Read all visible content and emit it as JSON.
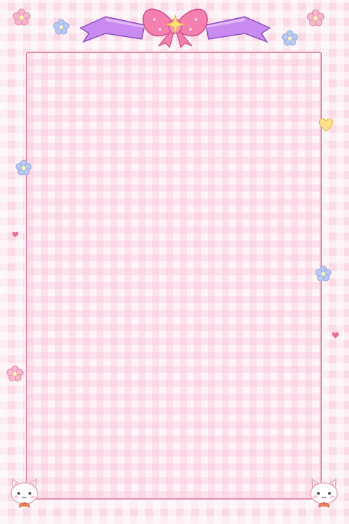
{
  "stationery": {
    "pattern": "pink gingham",
    "colors": {
      "background": "#fbd9e5",
      "panel": "#fff4f8",
      "panel_border": "#e58fae",
      "bow": "#f57fae",
      "ribbon": "#c98bef",
      "star": "#fbe17a",
      "flower_pink": "#f7b8cc",
      "flower_blue": "#b9c9f1",
      "heart_yellow": "#fde08b",
      "heart_pink": "#f06b95"
    },
    "decorations": [
      "pink-bow-icon",
      "purple-ribbon-icon",
      "star-icon",
      "flower-icon",
      "heart-icon",
      "kitten-icon"
    ]
  }
}
